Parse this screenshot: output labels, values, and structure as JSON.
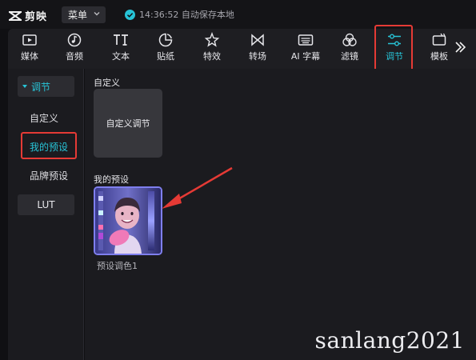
{
  "app": {
    "name": "剪映"
  },
  "menu": {
    "label": "菜单"
  },
  "autosave": {
    "text": "14:36:52 自动保存本地"
  },
  "tools": [
    {
      "label": "媒体",
      "icon": "media-icon"
    },
    {
      "label": "音频",
      "icon": "audio-icon"
    },
    {
      "label": "文本",
      "icon": "text-icon"
    },
    {
      "label": "贴纸",
      "icon": "sticker-icon"
    },
    {
      "label": "特效",
      "icon": "effects-icon"
    },
    {
      "label": "转场",
      "icon": "transition-icon"
    },
    {
      "label": "AI 字幕",
      "icon": "ai-subtitle-icon"
    },
    {
      "label": "滤镜",
      "icon": "filter-icon"
    },
    {
      "label": "调节",
      "icon": "adjust-icon",
      "active": true
    },
    {
      "label": "模板",
      "icon": "template-icon"
    }
  ],
  "sidebar": {
    "group": "调节",
    "items": [
      "自定义",
      "我的预设",
      "品牌预设"
    ],
    "active_item": "我的预设",
    "lut": "LUT"
  },
  "main": {
    "custom_section": "自定义",
    "custom_card": "自定义调节",
    "presets_section": "我的预设",
    "preset_name": "预设调色1"
  },
  "watermark": "sanlang2021",
  "colors": {
    "accent": "#27c3d6",
    "highlight": "#e53a35",
    "panel": "#1b1b1f",
    "background": "#101013"
  }
}
